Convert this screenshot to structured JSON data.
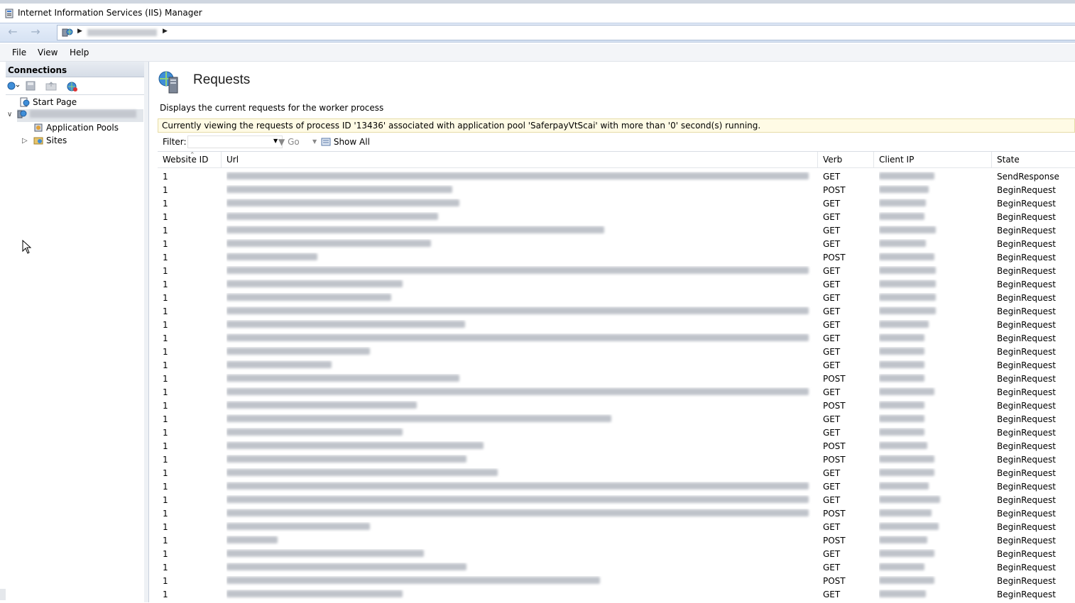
{
  "window": {
    "title": "Internet Information Services (IIS) Manager"
  },
  "menu": {
    "file": "File",
    "view": "View",
    "help": "Help"
  },
  "connections": {
    "header": "Connections",
    "tree": {
      "start_page": "Start Page",
      "app_pools": "Application Pools",
      "sites": "Sites"
    }
  },
  "page": {
    "title": "Requests",
    "description": "Displays the current requests for the worker process",
    "info": "Currently viewing the requests of process ID '13436' associated with application pool 'SaferpayVtScai' with more than '0' second(s) running.",
    "filter_label": "Filter:",
    "filter_value": "",
    "go_label": "Go",
    "show_all_label": "Show All"
  },
  "grid": {
    "columns": {
      "website_id": "Website ID",
      "url": "Url",
      "verb": "Verb",
      "client_ip": "Client IP",
      "state": "State"
    },
    "rows": [
      {
        "id": "1",
        "verb": "GET",
        "state": "SendResponse"
      },
      {
        "id": "1",
        "verb": "POST",
        "state": "BeginRequest"
      },
      {
        "id": "1",
        "verb": "GET",
        "state": "BeginRequest"
      },
      {
        "id": "1",
        "verb": "GET",
        "state": "BeginRequest"
      },
      {
        "id": "1",
        "verb": "GET",
        "state": "BeginRequest"
      },
      {
        "id": "1",
        "verb": "GET",
        "state": "BeginRequest"
      },
      {
        "id": "1",
        "verb": "POST",
        "state": "BeginRequest"
      },
      {
        "id": "1",
        "verb": "GET",
        "state": "BeginRequest"
      },
      {
        "id": "1",
        "verb": "GET",
        "state": "BeginRequest"
      },
      {
        "id": "1",
        "verb": "GET",
        "state": "BeginRequest"
      },
      {
        "id": "1",
        "verb": "GET",
        "state": "BeginRequest"
      },
      {
        "id": "1",
        "verb": "GET",
        "state": "BeginRequest"
      },
      {
        "id": "1",
        "verb": "GET",
        "state": "BeginRequest"
      },
      {
        "id": "1",
        "verb": "GET",
        "state": "BeginRequest"
      },
      {
        "id": "1",
        "verb": "GET",
        "state": "BeginRequest"
      },
      {
        "id": "1",
        "verb": "POST",
        "state": "BeginRequest"
      },
      {
        "id": "1",
        "verb": "GET",
        "state": "BeginRequest"
      },
      {
        "id": "1",
        "verb": "POST",
        "state": "BeginRequest"
      },
      {
        "id": "1",
        "verb": "GET",
        "state": "BeginRequest"
      },
      {
        "id": "1",
        "verb": "GET",
        "state": "BeginRequest"
      },
      {
        "id": "1",
        "verb": "POST",
        "state": "BeginRequest"
      },
      {
        "id": "1",
        "verb": "POST",
        "state": "BeginRequest"
      },
      {
        "id": "1",
        "verb": "GET",
        "state": "BeginRequest"
      },
      {
        "id": "1",
        "verb": "GET",
        "state": "BeginRequest"
      },
      {
        "id": "1",
        "verb": "GET",
        "state": "BeginRequest"
      },
      {
        "id": "1",
        "verb": "POST",
        "state": "BeginRequest"
      },
      {
        "id": "1",
        "verb": "GET",
        "state": "BeginRequest"
      },
      {
        "id": "1",
        "verb": "POST",
        "state": "BeginRequest"
      },
      {
        "id": "1",
        "verb": "GET",
        "state": "BeginRequest"
      },
      {
        "id": "1",
        "verb": "GET",
        "state": "BeginRequest"
      },
      {
        "id": "1",
        "verb": "POST",
        "state": "BeginRequest"
      },
      {
        "id": "1",
        "verb": "GET",
        "state": "BeginRequest"
      }
    ]
  }
}
